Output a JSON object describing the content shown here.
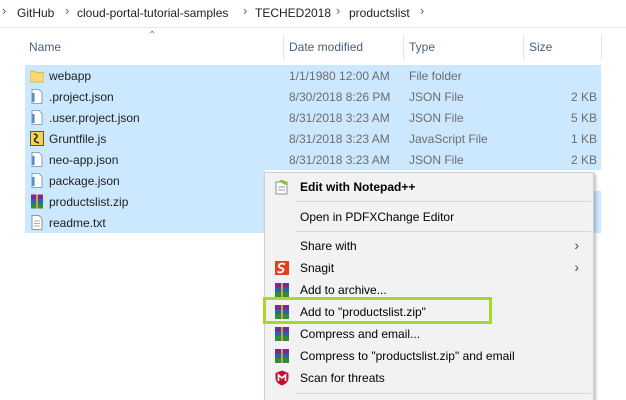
{
  "breadcrumb": {
    "items": [
      "GitHub",
      "cloud-portal-tutorial-samples",
      "TECHED2018",
      "productslist"
    ],
    "separator": "›"
  },
  "columns": {
    "name": "Name",
    "date": "Date modified",
    "type": "Type",
    "size": "Size"
  },
  "files": [
    {
      "name": "webapp",
      "date": "1/1/1980 12:00 AM",
      "type": "File folder",
      "size": "",
      "icon": "folder-icon"
    },
    {
      "name": ".project.json",
      "date": "8/30/2018 8:26 PM",
      "type": "JSON File",
      "size": "2 KB",
      "icon": "json-file-icon"
    },
    {
      "name": ".user.project.json",
      "date": "8/31/2018 3:23 AM",
      "type": "JSON File",
      "size": "5 KB",
      "icon": "json-file-icon"
    },
    {
      "name": "Gruntfile.js",
      "date": "8/31/2018 3:23 AM",
      "type": "JavaScript File",
      "size": "1 KB",
      "icon": "js-file-icon"
    },
    {
      "name": "neo-app.json",
      "date": "8/31/2018 3:23 AM",
      "type": "JSON File",
      "size": "2 KB",
      "icon": "json-file-icon"
    },
    {
      "name": "package.json",
      "date": "",
      "type": "",
      "size": "",
      "icon": "json-file-icon"
    },
    {
      "name": "productslist.zip",
      "date": "",
      "type": "",
      "size": "",
      "icon": "winrar-archive-icon"
    },
    {
      "name": "readme.txt",
      "date": "",
      "type": "",
      "size": "",
      "icon": "text-file-icon"
    }
  ],
  "context_menu": {
    "items": [
      {
        "label": "Edit with Notepad++",
        "bold": true,
        "icon": "notepadpp-icon",
        "submenu": false
      },
      {
        "label": "Open in PDFXChange Editor",
        "bold": false,
        "icon": "",
        "submenu": false
      },
      {
        "label": "Share with",
        "bold": false,
        "icon": "",
        "submenu": true
      },
      {
        "label": "Snagit",
        "bold": false,
        "icon": "snagit-icon",
        "submenu": true
      },
      {
        "label": "Add to archive...",
        "bold": false,
        "icon": "winrar-icon",
        "submenu": false
      },
      {
        "label": "Add to \"productslist.zip\"",
        "bold": false,
        "icon": "winrar-icon",
        "submenu": false
      },
      {
        "label": "Compress and email...",
        "bold": false,
        "icon": "winrar-icon",
        "submenu": false
      },
      {
        "label": "Compress to \"productslist.zip\" and email",
        "bold": false,
        "icon": "winrar-icon",
        "submenu": false
      },
      {
        "label": "Scan for threats",
        "bold": false,
        "icon": "mcafee-shield-icon",
        "submenu": false
      }
    ]
  },
  "colors": {
    "selection": "#cce8ff",
    "highlight_box": "#a9d62b",
    "menu_bg": "#f2f2f2"
  }
}
